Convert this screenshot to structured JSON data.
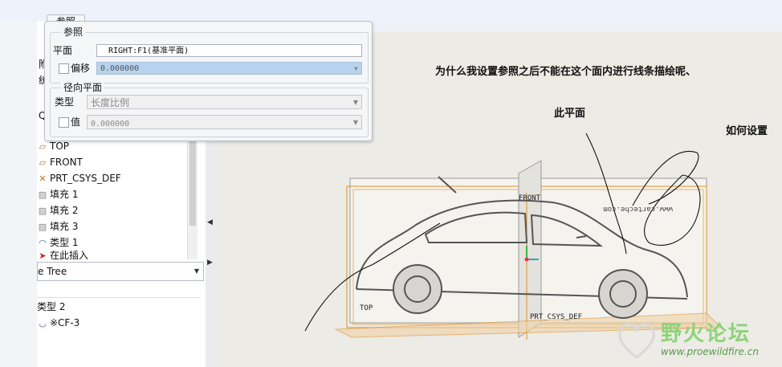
{
  "refs_tab": "参照",
  "refs_group": "参照",
  "plane_label": "平面",
  "plane_value": "RIGHT:F1(基准平面)",
  "offset_label": "偏移",
  "offset_value": "0.000000",
  "radial_group": "径向平面",
  "type_label": "类型",
  "type_value": "长度比例",
  "value_label": "值",
  "value_value": "0.000000",
  "edge_fragments": [
    "附",
    "统",
    "QI"
  ],
  "tree_items": [
    {
      "icon": "datum-plane-icon",
      "glyph": "▱",
      "label": "TOP"
    },
    {
      "icon": "datum-plane-icon",
      "glyph": "▱",
      "label": "FRONT"
    },
    {
      "icon": "coord-sys-icon",
      "glyph": "✕",
      "label": "PRT_CSYS_DEF"
    },
    {
      "icon": "fill-icon",
      "glyph": "▨",
      "label": "填充 1"
    },
    {
      "icon": "fill-icon",
      "glyph": "▨",
      "label": "填充 2"
    },
    {
      "icon": "fill-icon",
      "glyph": "▨",
      "label": "填充 3"
    },
    {
      "icon": "curve-icon",
      "glyph": "◠",
      "label": "类型 1"
    },
    {
      "icon": "insert-here-icon",
      "glyph": "➤",
      "label": "在此插入"
    }
  ],
  "tree_dropdown": "e Tree",
  "tree2_items": [
    {
      "label": "类型 2"
    },
    {
      "label": "※CF-3"
    }
  ],
  "notes": {
    "question": "为什么我设置参照之后不能在这个面内进行线条描绘呢、",
    "this_plane": "此平面",
    "how_set": "如何设置"
  },
  "model_labels": {
    "front": "FRONT",
    "top": "TOP",
    "csys": "PRT_CSYS_DEF",
    "car_site": "www.carteche.com"
  },
  "watermark": {
    "title": "野火论坛",
    "url": "www.proewildfire.cn"
  },
  "colors": {
    "accent_field": "#b8d3ee",
    "datum_orange": "#e0902a",
    "watermark_green": "#8ed37a"
  }
}
